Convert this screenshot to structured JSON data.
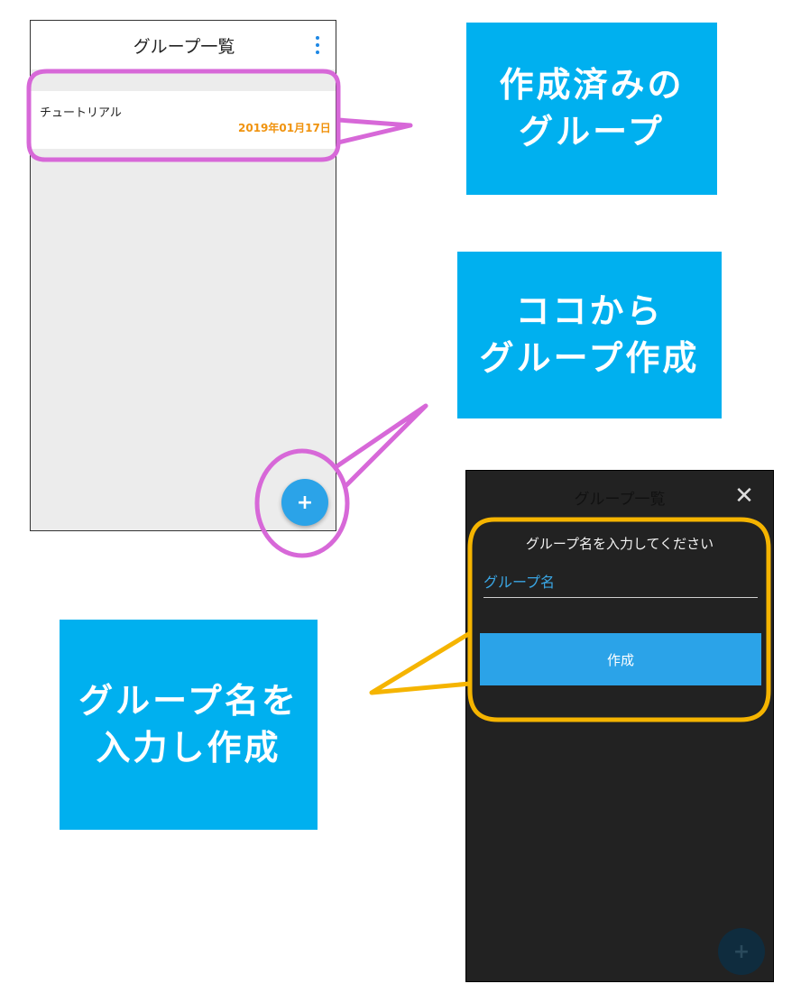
{
  "left_screen": {
    "title": "グループ一覧",
    "menu_icon": "vertical-dots-icon",
    "group_item": {
      "name": "チュートリアル",
      "date": "2019年01月17日"
    },
    "fab_label": "+"
  },
  "right_screen": {
    "title": "グループ一覧",
    "close_icon": "close-icon",
    "dialog": {
      "prompt": "グループ名を入力してください",
      "input_placeholder": "グループ名",
      "create_button": "作成"
    },
    "fab_label": "+"
  },
  "callouts": {
    "created_groups": {
      "line1": "作成済みの",
      "line2": "グループ"
    },
    "create_here": {
      "line1": "ココから",
      "line2": "グループ作成"
    },
    "enter_name": {
      "line1": "グループ名を",
      "line2": "入力し作成"
    }
  },
  "colors": {
    "accent_blue": "#2ba3e8",
    "callout_blue": "#00b0ef",
    "highlight_purple": "#d768d8",
    "highlight_yellow": "#f5b400",
    "date_orange": "#f0930e"
  }
}
